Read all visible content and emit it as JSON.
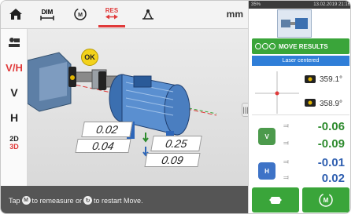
{
  "toolbar": {
    "dim_label": "DIM",
    "res_label": "RES",
    "units": "mm"
  },
  "left_toolbar": {
    "vh_label": "V/H",
    "v_label": "V",
    "h_label": "H",
    "d2_label": "2D",
    "d3_label": "3D"
  },
  "scene": {
    "ok_label": "OK",
    "vertical_offset": "0.02",
    "horizontal_offset": "0.25",
    "vertical_angular": "0.04",
    "horizontal_angular": "0.09"
  },
  "footer": {
    "text_prefix": "Tap",
    "text_middle": "to remeasure or",
    "text_suffix": "to restart Move."
  },
  "panel": {
    "status_battery": "35%",
    "status_datetime": "13.02.2019 21:16",
    "move_results_label": "MOVE RESULTS",
    "laser_status": "Laser centered",
    "angle_top": "359.1°",
    "angle_bottom": "358.9°",
    "v_badge": "V",
    "h_badge": "H",
    "v_value_top": "-0.06",
    "v_value_bottom": "-0.09",
    "h_value_top": "-0.01",
    "h_value_bottom": "0.02"
  },
  "colors": {
    "accent_red": "#e03a3a",
    "green": "#3aa53a",
    "blue": "#2f7ed8",
    "negative_green": "#2e8b2e",
    "h_blue": "#2f5fb0"
  }
}
